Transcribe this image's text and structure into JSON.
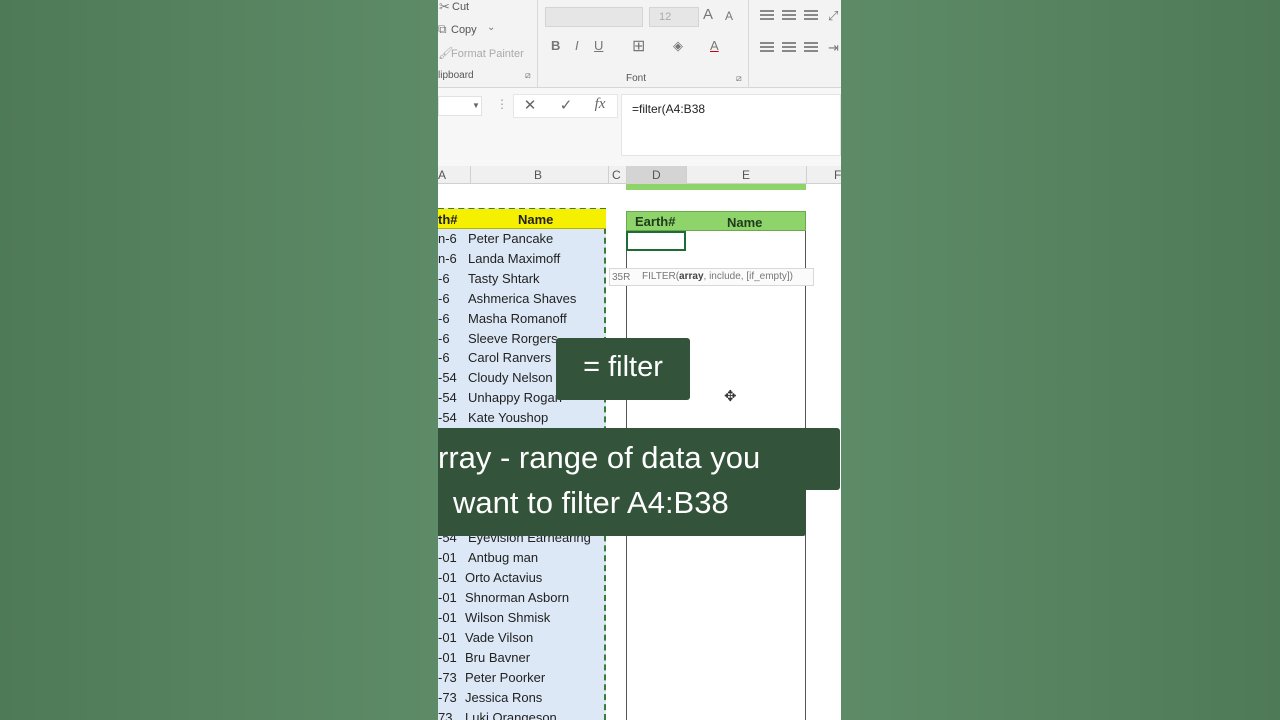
{
  "ribbon": {
    "cut_label": "Cut",
    "copy_label": "Copy",
    "format_painter_label": "Format Painter",
    "clipboard_group": "lipboard",
    "font_group": "Font",
    "font_size": "12",
    "bold": "B",
    "italic": "I",
    "underline": "U",
    "grow_font": "A",
    "shrink_font": "A",
    "font_color": "A"
  },
  "formula_bar": {
    "formula": "=filter(A4:B38",
    "cancel_glyph": "✕",
    "enter_glyph": "✓",
    "fx_glyph": "fx"
  },
  "columns": [
    "A",
    "B",
    "C",
    "D",
    "E",
    "F"
  ],
  "source_table": {
    "header_earth": "th#",
    "header_name": "Name",
    "rows": [
      {
        "earth": "n-6",
        "name": "Peter Pancake"
      },
      {
        "earth": "n-6",
        "name": "Landa Maximoff"
      },
      {
        "earth": "-6",
        "name": "Tasty Shtark"
      },
      {
        "earth": "-6",
        "name": "Ashmerica Shaves"
      },
      {
        "earth": "-6",
        "name": "Masha Romanoff"
      },
      {
        "earth": "-6",
        "name": "Sleeve Rorgers"
      },
      {
        "earth": "-6",
        "name": "Carol Ranvers"
      },
      {
        "earth": "-54",
        "name": "Cloudy Nelson"
      },
      {
        "earth": "-54",
        "name": "Unhappy Rogan"
      },
      {
        "earth": "-54",
        "name": "Kate Youshop"
      },
      {
        "earth": "-54",
        "name": "Eyevision Earhearing"
      },
      {
        "earth": "-01",
        "name": "Antbug man"
      },
      {
        "earth": "-01",
        "name": "Orto Actavius"
      },
      {
        "earth": "-01",
        "name": "Shnorman Asborn"
      },
      {
        "earth": "-01",
        "name": "Wilson Shmisk"
      },
      {
        "earth": "-01",
        "name": "Vade Vilson"
      },
      {
        "earth": "-01",
        "name": "Bru Bavner"
      },
      {
        "earth": "-73",
        "name": "Peter Poorker"
      },
      {
        "earth": "-73",
        "name": "Jessica Rons"
      },
      {
        "earth": "73",
        "name": "Luki Orangeson"
      }
    ]
  },
  "result_table": {
    "header_earth": "Earth#",
    "header_name": "Name"
  },
  "tooltip": {
    "cell_ref": "35R",
    "fn": "FILTER(",
    "arg1": "array",
    "rest": ", include, [if_empty])"
  },
  "captions": {
    "title": "= filter",
    "line1": "rray - range of data you",
    "line2": "want to filter A4:B38"
  }
}
